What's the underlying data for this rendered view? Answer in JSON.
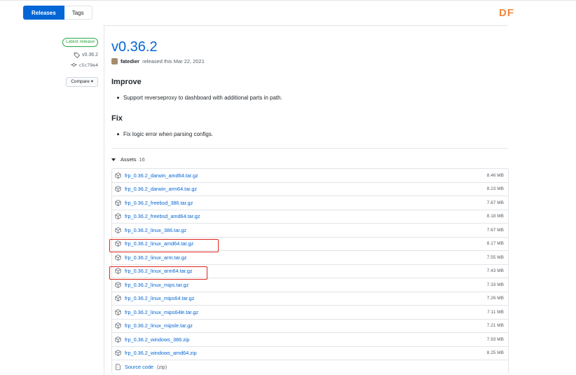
{
  "tabs": {
    "releases": "Releases",
    "tags": "Tags"
  },
  "watermark": "DF",
  "meta": {
    "latest_release": "Latest release",
    "tag": "v0.36.2",
    "commit": "c5c79e4",
    "compare": "Compare"
  },
  "release": {
    "title": "v0.36.2",
    "author": "fatedier",
    "released_text": "released this Mar 22, 2021"
  },
  "notes": {
    "improve_heading": "Improve",
    "improve_items": [
      "Support reverseproxy to dashboard with additional parts in path."
    ],
    "fix_heading": "Fix",
    "fix_items": [
      "Fix logic error when parsing configs."
    ]
  },
  "assets": {
    "label": "Assets",
    "count": "16",
    "items": [
      {
        "name": "frp_0.36.2_darwin_amd64.tar.gz",
        "size": "8.46 MB"
      },
      {
        "name": "frp_0.36.2_darwin_arm64.tar.gz",
        "size": "8.23 MB"
      },
      {
        "name": "frp_0.36.2_freebsd_386.tar.gz",
        "size": "7.67 MB"
      },
      {
        "name": "frp_0.36.2_freebsd_amd64.tar.gz",
        "size": "8.18 MB"
      },
      {
        "name": "frp_0.36.2_linux_386.tar.gz",
        "size": "7.67 MB"
      },
      {
        "name": "frp_0.36.2_linux_amd64.tar.gz",
        "size": "8.17 MB"
      },
      {
        "name": "frp_0.36.2_linux_arm.tar.gz",
        "size": "7.55 MB"
      },
      {
        "name": "frp_0.36.2_linux_arm64.tar.gz",
        "size": "7.43 MB"
      },
      {
        "name": "frp_0.36.2_linux_mips.tar.gz",
        "size": "7.33 MB"
      },
      {
        "name": "frp_0.36.2_linux_mips64.tar.gz",
        "size": "7.26 MB"
      },
      {
        "name": "frp_0.36.2_linux_mips64le.tar.gz",
        "size": "7.11 MB"
      },
      {
        "name": "frp_0.36.2_linux_mipsle.tar.gz",
        "size": "7.21 MB"
      },
      {
        "name": "frp_0.36.2_windows_386.zip",
        "size": "7.93 MB"
      },
      {
        "name": "frp_0.36.2_windows_amd64.zip",
        "size": "8.25 MB"
      }
    ],
    "source_code": "Source code",
    "source_zip": "(zip)"
  },
  "colors": {
    "accent": "#0366d6",
    "highlight": "#e0251b",
    "latest": "#28a745",
    "watermark": "#f0883e"
  }
}
